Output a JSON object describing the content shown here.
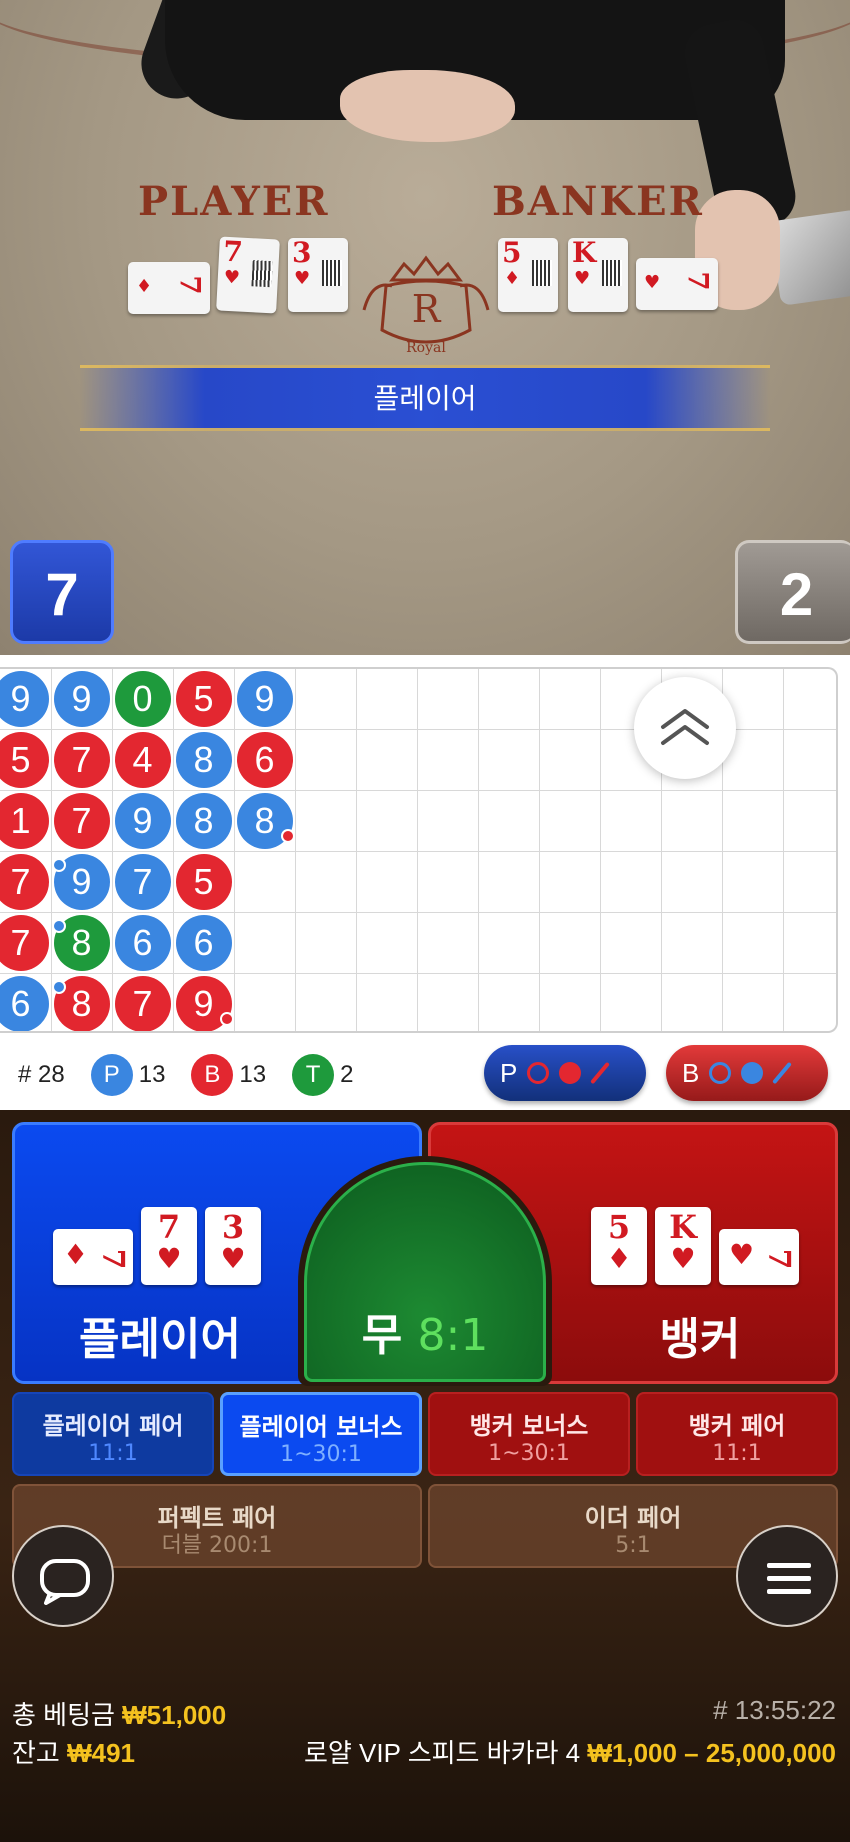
{
  "video": {
    "felt_player": "PLAYER",
    "felt_banker": "BANKER",
    "logo_letter": "R",
    "logo_text": "Royal",
    "result_banner": "플레이어",
    "player_score": "7",
    "banker_score": "2",
    "player_cards": [
      {
        "rank": "7",
        "suit": "♦"
      },
      {
        "rank": "7",
        "suit": "♥"
      },
      {
        "rank": "3",
        "suit": "♥"
      }
    ],
    "banker_cards": [
      {
        "rank": "5",
        "suit": "♦"
      },
      {
        "rank": "K",
        "suit": "♥"
      },
      {
        "rank": "7",
        "suit": "♥"
      }
    ]
  },
  "road": {
    "beads": [
      {
        "col": 0,
        "row": 0,
        "v": "9",
        "c": "p"
      },
      {
        "col": 1,
        "row": 0,
        "v": "9",
        "c": "p"
      },
      {
        "col": 2,
        "row": 0,
        "v": "0",
        "c": "t"
      },
      {
        "col": 3,
        "row": 0,
        "v": "5",
        "c": "b"
      },
      {
        "col": 4,
        "row": 0,
        "v": "9",
        "c": "p"
      },
      {
        "col": 0,
        "row": 1,
        "v": "5",
        "c": "b"
      },
      {
        "col": 1,
        "row": 1,
        "v": "7",
        "c": "b"
      },
      {
        "col": 2,
        "row": 1,
        "v": "4",
        "c": "b"
      },
      {
        "col": 3,
        "row": 1,
        "v": "8",
        "c": "p"
      },
      {
        "col": 4,
        "row": 1,
        "v": "6",
        "c": "b"
      },
      {
        "col": 0,
        "row": 2,
        "v": "1",
        "c": "b"
      },
      {
        "col": 1,
        "row": 2,
        "v": "7",
        "c": "b"
      },
      {
        "col": 2,
        "row": 2,
        "v": "9",
        "c": "p"
      },
      {
        "col": 3,
        "row": 2,
        "v": "8",
        "c": "p"
      },
      {
        "col": 4,
        "row": 2,
        "v": "8",
        "c": "p",
        "dot": "rd"
      },
      {
        "col": 0,
        "row": 3,
        "v": "7",
        "c": "b"
      },
      {
        "col": 1,
        "row": 3,
        "v": "9",
        "c": "p",
        "dot": "bl"
      },
      {
        "col": 2,
        "row": 3,
        "v": "7",
        "c": "p"
      },
      {
        "col": 3,
        "row": 3,
        "v": "5",
        "c": "b"
      },
      {
        "col": 0,
        "row": 4,
        "v": "7",
        "c": "b"
      },
      {
        "col": 1,
        "row": 4,
        "v": "8",
        "c": "t",
        "dot": "bl"
      },
      {
        "col": 2,
        "row": 4,
        "v": "6",
        "c": "p"
      },
      {
        "col": 3,
        "row": 4,
        "v": "6",
        "c": "p"
      },
      {
        "col": 0,
        "row": 5,
        "v": "6",
        "c": "p"
      },
      {
        "col": 1,
        "row": 5,
        "v": "8",
        "c": "b",
        "dot": "bl"
      },
      {
        "col": 2,
        "row": 5,
        "v": "7",
        "c": "b"
      },
      {
        "col": 3,
        "row": 5,
        "v": "9",
        "c": "b",
        "dot": "rd"
      }
    ],
    "total_label": "# 28",
    "p_letter": "P",
    "p_count": "13",
    "b_letter": "B",
    "b_count": "13",
    "t_letter": "T",
    "t_count": "2",
    "predict_p": "P",
    "predict_b": "B"
  },
  "bets": {
    "player_label": "플레이어",
    "banker_label": "뱅커",
    "tie_label": "무",
    "tie_odds": "8:1",
    "player_cards": [
      {
        "rank": "7",
        "suit": "♦",
        "side": true
      },
      {
        "rank": "7",
        "suit": "♥"
      },
      {
        "rank": "3",
        "suit": "♥"
      }
    ],
    "banker_cards": [
      {
        "rank": "5",
        "suit": "♦"
      },
      {
        "rank": "K",
        "suit": "♥"
      },
      {
        "rank": "7",
        "suit": "♥",
        "side": true
      }
    ],
    "player_pair": {
      "label": "플레이어 페어",
      "odds": "11:1"
    },
    "player_bonus": {
      "label": "플레이어 보너스",
      "odds": "1~30:1"
    },
    "banker_bonus": {
      "label": "뱅커 보너스",
      "odds": "1~30:1"
    },
    "banker_pair": {
      "label": "뱅커 페어",
      "odds": "11:1"
    },
    "perfect_pair": {
      "label": "퍼펙트 페어",
      "odds": "더블 200:1"
    },
    "either_pair": {
      "label": "이더 페어",
      "odds": "5:1"
    }
  },
  "footer": {
    "total_bet_label": "총 베팅금",
    "total_bet_value": "₩51,000",
    "balance_label": "잔고",
    "balance_value": "₩491",
    "time": "# 13:55:22",
    "table_name": "로얄 VIP 스피드 바카라 4",
    "limits": "₩1,000 – 25,000,000"
  },
  "colors": {
    "player_blue": "#0b4af0",
    "banker_red": "#c41414",
    "tie_green": "#1d8a32",
    "gold": "#f4c21f"
  }
}
